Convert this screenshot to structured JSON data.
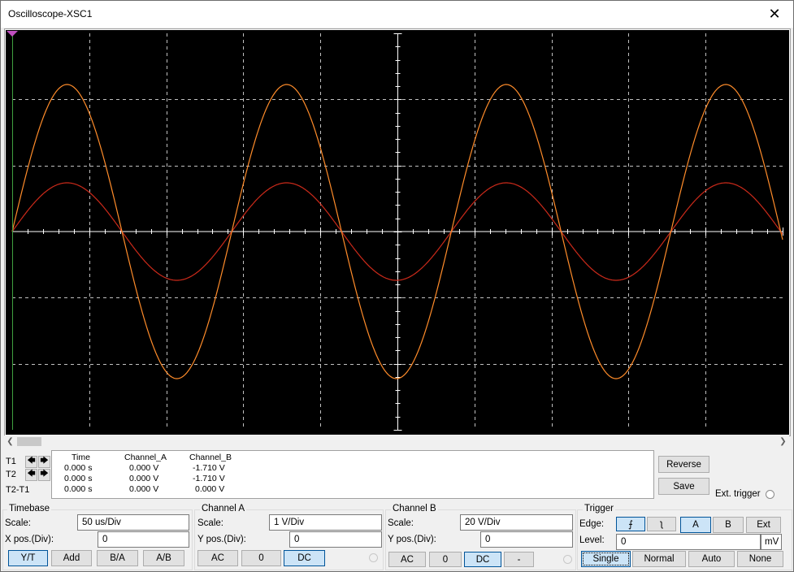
{
  "window": {
    "title": "Oscilloscope-XSC1",
    "close_glyph": "✕"
  },
  "screen": {
    "background": "#000000",
    "grid_color": "#c0c0c0",
    "axis_color": "#ffffff",
    "channel_a_color": "#cc2a1a",
    "channel_b_color": "#ff8c2a",
    "cursor_t1_color": "#c050c0",
    "cursor_t2_color": "#40a040"
  },
  "scrollbar": {
    "left_glyph": "❮",
    "right_glyph": "❯"
  },
  "cursors": {
    "t1_label": "T1",
    "t2_label": "T2",
    "t2t1_label": "T2-T1",
    "left_glyph": "🡄",
    "right_glyph": "🡆"
  },
  "readout": {
    "headers": [
      "Time",
      "Channel_A",
      "Channel_B"
    ],
    "rows": [
      [
        "0.000 s",
        "0.000 V",
        "-1.710 V"
      ],
      [
        "0.000 s",
        "0.000 V",
        "-1.710 V"
      ],
      [
        "0.000 s",
        "0.000 V",
        "0.000 V"
      ]
    ]
  },
  "side": {
    "reverse_label": "Reverse",
    "save_label": "Save",
    "ext_trigger_label": "Ext. trigger"
  },
  "timebase": {
    "title": "Timebase",
    "scale_label": "Scale:",
    "scale_value": "50 us/Div",
    "xpos_label": "X pos.(Div):",
    "xpos_value": "0",
    "modes": [
      "Y/T",
      "Add",
      "B/A",
      "A/B"
    ],
    "selected_mode": "Y/T"
  },
  "channel_a": {
    "title": "Channel A",
    "scale_label": "Scale:",
    "scale_value": "1  V/Div",
    "ypos_label": "Y pos.(Div):",
    "ypos_value": "0",
    "coupling": [
      "AC",
      "0",
      "DC"
    ],
    "selected_coupling": "DC"
  },
  "channel_b": {
    "title": "Channel B",
    "scale_label": "Scale:",
    "scale_value": "20  V/Div",
    "ypos_label": "Y pos.(Div):",
    "ypos_value": "0",
    "coupling": [
      "AC",
      "0",
      "DC",
      "-"
    ],
    "selected_coupling": "DC"
  },
  "trigger": {
    "title": "Trigger",
    "edge_label": "Edge:",
    "rising_glyph": "⨍",
    "falling_glyph": "ʅ",
    "sources": [
      "A",
      "B",
      "Ext"
    ],
    "selected_source": "A",
    "level_label": "Level:",
    "level_value": "0",
    "level_unit": "mV",
    "modes": [
      "Single",
      "Normal",
      "Auto",
      "None"
    ],
    "selected_mode": "Single"
  }
}
